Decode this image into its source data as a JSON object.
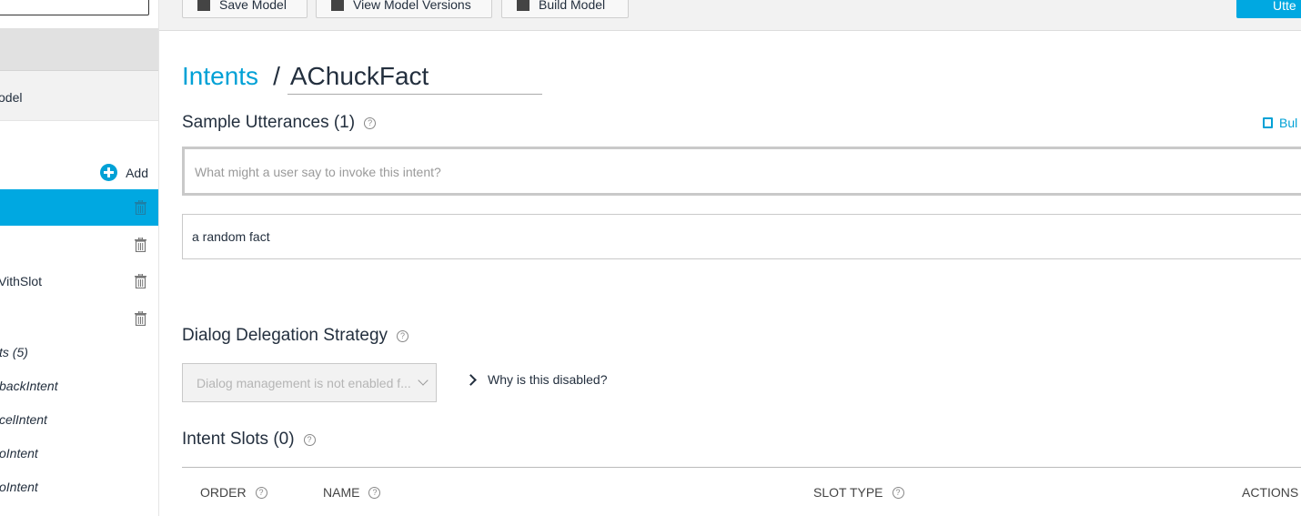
{
  "toolbar": {
    "save_model": "Save Model",
    "view_versions": "View Model Versions",
    "build_model": "Build Model",
    "primary": "Utte"
  },
  "sidebar": {
    "model_label": "odel",
    "add_label": "Add",
    "intents": [
      {
        "label": ""
      },
      {
        "label": ""
      },
      {
        "label": "VithSlot"
      },
      {
        "label": ""
      }
    ],
    "builtin_header": "ts (5)",
    "builtin_items": [
      "backIntent",
      "celIntent",
      "oIntent",
      "oIntent"
    ]
  },
  "breadcrumb": {
    "intents_link": "Intents",
    "separator": "/",
    "intent_name": "AChuckFact"
  },
  "sample_utterances": {
    "title": "Sample Utterances (1)",
    "bulk_label": "Bul",
    "placeholder": "What might a user say to invoke this intent?",
    "items": [
      "a random fact"
    ]
  },
  "dialog_delegation": {
    "title": "Dialog Delegation Strategy",
    "select_value": "Dialog management is not enabled f...",
    "why_label": "Why is this disabled?"
  },
  "intent_slots": {
    "title": "Intent Slots (0)",
    "columns": {
      "order": "ORDER",
      "name": "NAME",
      "slot_type": "SLOT TYPE",
      "actions": "ACTIONS"
    }
  },
  "help_glyph": "?",
  "colors": {
    "accent": "#00a8e1",
    "link": "#00a1d6"
  }
}
